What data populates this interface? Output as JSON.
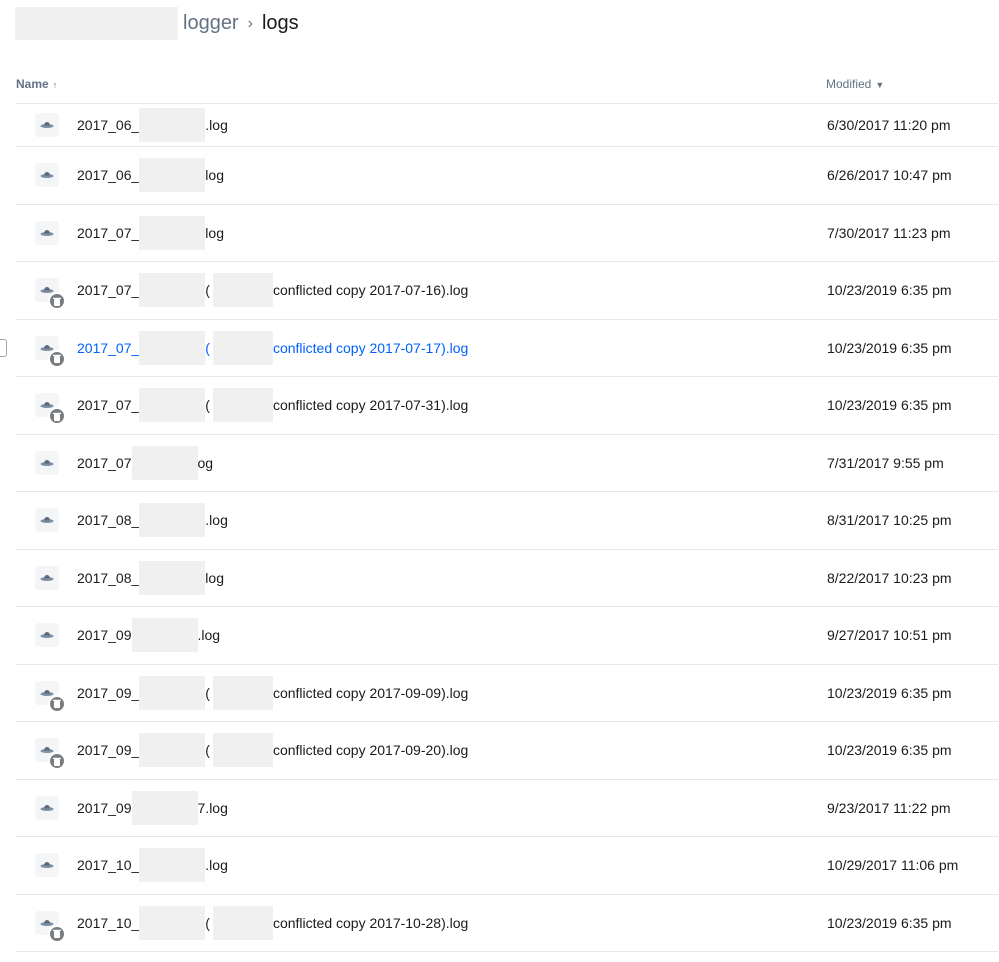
{
  "breadcrumb": {
    "parent": "logger",
    "separator": "›",
    "current": "logs"
  },
  "columns": {
    "name": "Name",
    "name_sort_icon": "sort-ascending-arrow",
    "modified": "Modified",
    "modified_sort_icon": "caret-down"
  },
  "icons": {
    "file": "ufo-file-icon",
    "deleted": "trash-badge-icon"
  },
  "colors": {
    "text": "#1e1919",
    "muted": "#637282",
    "link": "#0061fe",
    "divider": "#e6e8eb",
    "redaction": "#f0f0f0"
  },
  "rows": [
    {
      "prefix": "2017_06_",
      "suffix": ".log",
      "modified": "6/30/2017 11:20 pm",
      "conflicted": false
    },
    {
      "prefix": "2017_06_",
      "suffix": "log",
      "modified": "6/26/2017 10:47 pm",
      "conflicted": false
    },
    {
      "prefix": "2017_07_",
      "suffix": "log",
      "modified": "7/30/2017 11:23 pm",
      "conflicted": false
    },
    {
      "prefix": "2017_07_",
      "paren": "(",
      "suffix": "conflicted copy 2017-07-16).log",
      "modified": "10/23/2019 6:35 pm",
      "conflicted": true
    },
    {
      "prefix": "2017_07_",
      "paren": "(",
      "suffix": "conflicted copy 2017-07-17).log",
      "modified": "10/23/2019 6:35 pm",
      "conflicted": true,
      "hover": true
    },
    {
      "prefix": "2017_07_",
      "paren": "(",
      "suffix": "conflicted copy 2017-07-31).log",
      "modified": "10/23/2019 6:35 pm",
      "conflicted": true
    },
    {
      "prefix": "2017_07",
      "suffix": "og",
      "modified": "7/31/2017 9:55 pm",
      "conflicted": false
    },
    {
      "prefix": "2017_08_",
      "suffix": ".log",
      "modified": "8/31/2017 10:25 pm",
      "conflicted": false
    },
    {
      "prefix": "2017_08_",
      "suffix": "log",
      "modified": "8/22/2017 10:23 pm",
      "conflicted": false
    },
    {
      "prefix": "2017_09",
      "suffix": ".log",
      "modified": "9/27/2017 10:51 pm",
      "conflicted": false
    },
    {
      "prefix": "2017_09_",
      "paren": "(",
      "suffix": "conflicted copy 2017-09-09).log",
      "modified": "10/23/2019 6:35 pm",
      "conflicted": true
    },
    {
      "prefix": "2017_09_",
      "paren": "(",
      "suffix": "conflicted copy 2017-09-20).log",
      "modified": "10/23/2019 6:35 pm",
      "conflicted": true
    },
    {
      "prefix": "2017_09",
      "suffix": "7.log",
      "modified": "9/23/2017 11:22 pm",
      "conflicted": false
    },
    {
      "prefix": "2017_10_",
      "suffix": ".log",
      "modified": "10/29/2017 11:06 pm",
      "conflicted": false
    },
    {
      "prefix": "2017_10_",
      "paren": "(",
      "suffix": "conflicted copy 2017-10-28).log",
      "modified": "10/23/2019 6:35 pm",
      "conflicted": true
    }
  ]
}
